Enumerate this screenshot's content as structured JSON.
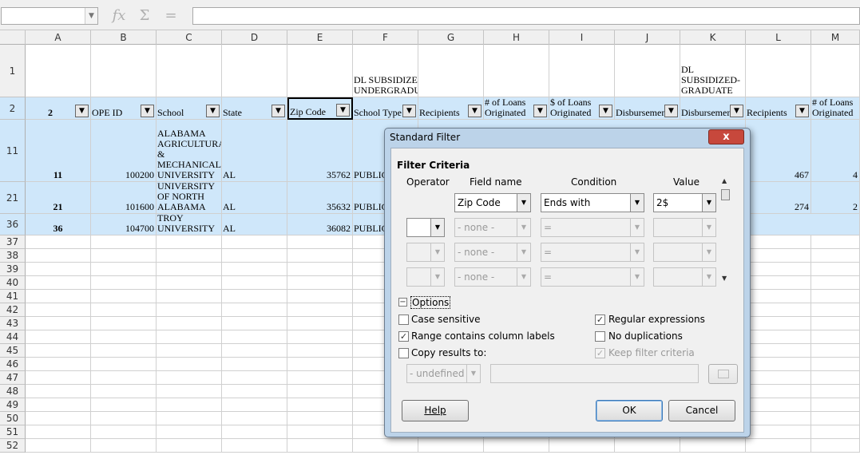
{
  "toolbar": {
    "function_wizard_icon": "fx",
    "sum_icon": "Σ",
    "formula_icon": "="
  },
  "columns": [
    "A",
    "B",
    "C",
    "D",
    "E",
    "F",
    "G",
    "H",
    "I",
    "J",
    "K",
    "L",
    "M"
  ],
  "rows": {
    "r1": {
      "num": "1",
      "F": "DL SUBSIDIZED-UNDERGRADUATE",
      "K": "DL SUBSIDIZED-GRADUATE"
    },
    "r2": {
      "num": "2",
      "A": "2",
      "B": "OPE ID",
      "C": "School",
      "D": "State",
      "E": "Zip Code",
      "F": "School Type",
      "G": "Recipients",
      "H": "# of Loans Originated",
      "I": "$ of Loans Originated",
      "J": "Disbursements",
      "K": "Disbursements",
      "L": "Recipients",
      "M": "# of Loans Originated"
    },
    "r11": {
      "num": "11",
      "A": "11",
      "B": "100200",
      "C": "ALABAMA AGRICULTURAL & MECHANICAL UNIVERSITY",
      "D": "AL",
      "E": "35762",
      "F": "PUBLIC",
      "L": "467",
      "M": "4"
    },
    "r21": {
      "num": "21",
      "A": "21",
      "B": "101600",
      "C": "UNIVERSITY OF NORTH ALABAMA",
      "D": "AL",
      "E": "35632",
      "F": "PUBLIC",
      "L": "274",
      "M": "2"
    },
    "r36": {
      "num": "36",
      "A": "36",
      "B": "104700",
      "C": "TROY UNIVERSITY",
      "D": "AL",
      "E": "36082",
      "F": "PUBLIC"
    }
  },
  "empty_rows": [
    "37",
    "38",
    "39",
    "40",
    "41",
    "42",
    "43",
    "44",
    "45",
    "46",
    "47",
    "48",
    "49",
    "50",
    "51",
    "52"
  ],
  "dialog": {
    "title": "Standard Filter",
    "close_icon": "x",
    "section_criteria": "Filter Criteria",
    "col_operator": "Operator",
    "col_field": "Field name",
    "col_condition": "Condition",
    "col_value": "Value",
    "criteria": [
      {
        "operator": "",
        "field": "Zip Code",
        "condition": "Ends with",
        "value": "2$"
      },
      {
        "operator": "",
        "field": "- none -",
        "condition": "=",
        "value": ""
      },
      {
        "operator": "",
        "field": "- none -",
        "condition": "=",
        "value": ""
      },
      {
        "operator": "",
        "field": "- none -",
        "condition": "=",
        "value": ""
      }
    ],
    "options_label": "Options",
    "options_toggle": "−",
    "case_sensitive": "Case sensitive",
    "range_labels": "Range contains column labels",
    "copy_results": "Copy results to:",
    "regex": "Regular expressions",
    "no_dup": "No duplications",
    "keep_filter": "Keep filter criteria",
    "copy_target": "- undefined -",
    "help": "Help",
    "ok": "OK",
    "cancel": "Cancel",
    "checked": "✓",
    "scroll_up": "▲",
    "scroll_down": "▼",
    "dropdown_arrow": "▼"
  }
}
